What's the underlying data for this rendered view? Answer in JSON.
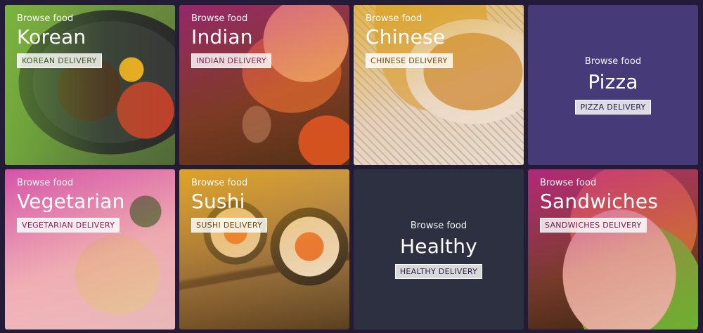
{
  "tiles": [
    {
      "browse": "Browse food",
      "name": "Korean",
      "badge": "KOREAN DELIVERY"
    },
    {
      "browse": "Browse food",
      "name": "Indian",
      "badge": "INDIAN DELIVERY"
    },
    {
      "browse": "Browse food",
      "name": "Chinese",
      "badge": "CHINESE DELIVERY"
    },
    {
      "browse": "Browse food",
      "name": "Pizza",
      "badge": "PIZZA DELIVERY"
    },
    {
      "browse": "Browse food",
      "name": "Vegetarian",
      "badge": "VEGETARIAN DELIVERY"
    },
    {
      "browse": "Browse food",
      "name": "Sushi",
      "badge": "SUSHI DELIVERY"
    },
    {
      "browse": "Browse food",
      "name": "Healthy",
      "badge": "HEALTHY DELIVERY"
    },
    {
      "browse": "Browse food",
      "name": "Sandwiches",
      "badge": "SANDWICHES DELIVERY"
    }
  ],
  "colors": {
    "background": "#231b38",
    "pizza_tile": "#463a78",
    "healthy_tile": "#2d3041"
  }
}
